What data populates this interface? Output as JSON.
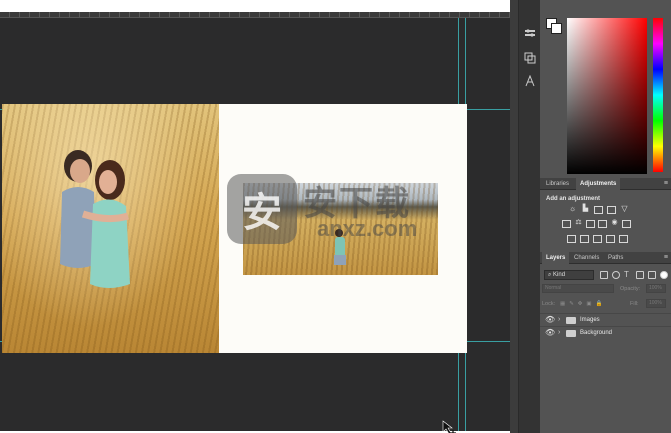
{
  "colors": {
    "canvas_bg": "#2b2b2c",
    "panel_bg": "#535353",
    "guide": "#3fc7c9",
    "document_bg": "#fdfcf8"
  },
  "toolstrip": {
    "icons": [
      "properties-icon",
      "history-icon",
      "character-icon"
    ]
  },
  "color_panel": {
    "foreground": "#ffffff",
    "background": "#ffffff"
  },
  "adjustments_panel": {
    "tabs": [
      "Libraries",
      "Adjustments"
    ],
    "active_tab": "Adjustments",
    "title": "Add an adjustment",
    "icons_row1": [
      "brightness-contrast-icon",
      "levels-icon",
      "curves-icon",
      "exposure-icon",
      "vibrance-icon"
    ],
    "icons_row2": [
      "hue-saturation-icon",
      "color-balance-icon",
      "black-white-icon",
      "photo-filter-icon",
      "channel-mixer-icon",
      "color-lookup-icon"
    ],
    "icons_row3": [
      "invert-icon",
      "posterize-icon",
      "threshold-icon",
      "gradient-map-icon",
      "selective-color-icon"
    ]
  },
  "layers_panel": {
    "tabs": [
      "Layers",
      "Channels",
      "Paths"
    ],
    "active_tab": "Layers",
    "filter_kind": "Kind",
    "blend_mode": "Normal",
    "opacity_label": "Opacity:",
    "opacity_value": "100%",
    "lock_label": "Lock:",
    "fill_label": "Fill:",
    "fill_value": "100%",
    "layers": [
      {
        "name": "Images",
        "type": "group"
      },
      {
        "name": "Background",
        "type": "group"
      }
    ]
  },
  "watermark": {
    "shield": "安",
    "text_cn": "安下载",
    "text_en": "anxz.com"
  }
}
